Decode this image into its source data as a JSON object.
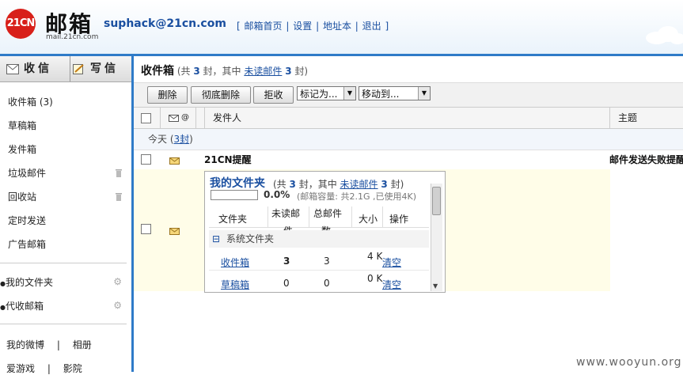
{
  "header": {
    "logo_badge": "21CN",
    "logo_text": "邮箱",
    "logo_domain": "mail.21cn.com",
    "user_email": "suphack@21cn.com",
    "nav_open": "[",
    "nav_close": "]",
    "nav": [
      "邮箱首页",
      "设置",
      "地址本",
      "退出"
    ],
    "nav_sep": "|"
  },
  "sidebar": {
    "receive_label": "收信",
    "write_label": "写信",
    "folders": [
      {
        "label": "收件箱 (3)"
      },
      {
        "label": "草稿箱"
      },
      {
        "label": "发件箱"
      },
      {
        "label": "垃圾邮件"
      },
      {
        "label": "回收站"
      },
      {
        "label": "定时发送"
      },
      {
        "label": "广告邮箱"
      }
    ],
    "my_folders": "我的文件夹",
    "proxy_mail": "代收邮箱",
    "bottom_links": [
      [
        "我的微博",
        "相册"
      ],
      [
        "爱游戏",
        "影院"
      ]
    ],
    "sep": "|"
  },
  "main": {
    "title": "收件箱",
    "summary_pre": "(共",
    "total": "3",
    "summary_mid": "封，其中",
    "unread_link": "未读邮件",
    "unread": "3",
    "summary_post": "封)",
    "toolbar": {
      "delete": "删除",
      "purge": "彻底删除",
      "reject": "拒收",
      "mark_as": "标记为...",
      "move_to": "移动到..."
    },
    "columns": {
      "sender": "发件人",
      "subject": "主题",
      "attach_mark": "@"
    },
    "group_label_pre": "今天 (",
    "group_count": "3封",
    "group_label_post": ")",
    "rows": [
      {
        "sender": "21CN提醒",
        "subject": "邮件发送失败提醒"
      }
    ]
  },
  "folder_panel": {
    "title": "我的文件夹",
    "sub_pre": "(共",
    "total": "3",
    "sub_mid": "封，其中",
    "unread_link": "未读邮件",
    "unread": "3",
    "sub_post": "封)",
    "usage_percent": "0.0%",
    "capacity": "(邮箱容量: 共2.1G ,已使用4K)",
    "cols": {
      "folder": "文件夹",
      "unread_1": "未读邮",
      "unread_2": "件",
      "total_1": "总邮件",
      "total_2": "数",
      "size": "大小",
      "action": "操作"
    },
    "group": "系统文件夹",
    "group_toggle": "⊟",
    "rows": [
      {
        "name": "收件箱",
        "unread": "3",
        "total": "3",
        "size": "4 K",
        "action": "清空"
      },
      {
        "name": "草稿箱",
        "unread": "0",
        "total": "0",
        "size": "0 K",
        "action": "清空"
      }
    ]
  },
  "watermark": "www.wooyun.org"
}
